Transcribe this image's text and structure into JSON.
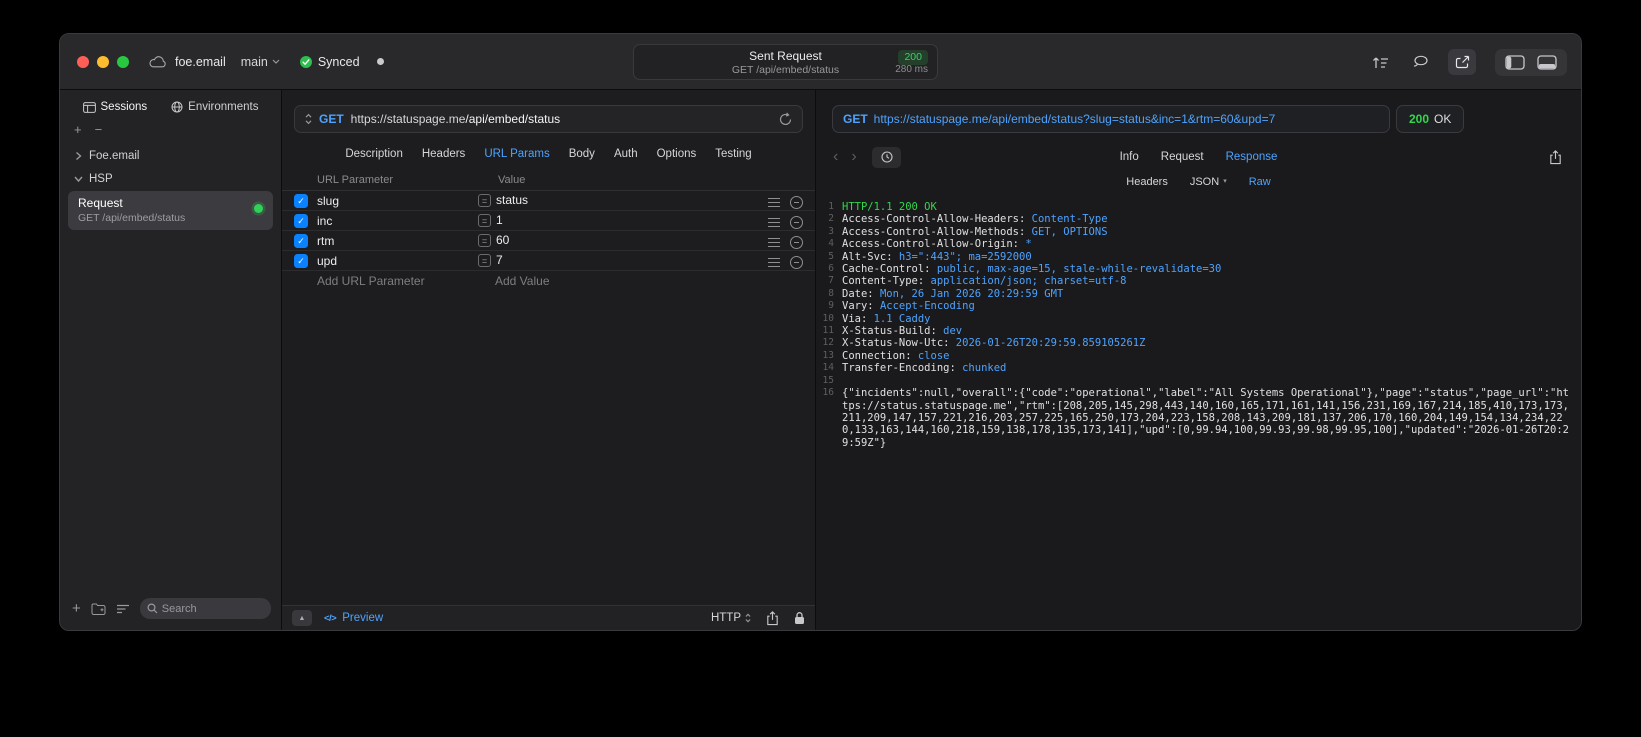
{
  "colors": {
    "accent_blue": "#4da3ff",
    "status_green": "#32d74b",
    "checkbox_blue": "#0a82ff"
  },
  "icons": {
    "check": "✓",
    "equals": "=",
    "plus": "+",
    "minus": "−",
    "triangle_up": "▲",
    "code_glyph": "</>",
    "back": "‹",
    "forward": "›",
    "dropdown_small": "▾"
  },
  "titlebar": {
    "project": "foe.email",
    "branch": "main",
    "sync_status": "Synced",
    "center": {
      "title": "Sent Request",
      "status_code": "200",
      "subtitle": "GET /api/embed/status",
      "duration": "280 ms"
    }
  },
  "sidebar": {
    "tabs": [
      {
        "label": "Sessions",
        "active": true
      },
      {
        "label": "Environments",
        "active": false
      }
    ],
    "tree": [
      {
        "label": "Foe.email",
        "expanded": false
      },
      {
        "label": "HSP",
        "expanded": true
      }
    ],
    "request_item": {
      "title": "Request",
      "subtitle": "GET /api/embed/status"
    },
    "search_placeholder": "Search"
  },
  "request_pane": {
    "method": "GET",
    "url_host": "https://statuspage.me",
    "url_path": "/api/embed/status",
    "tabs": [
      {
        "label": "Description"
      },
      {
        "label": "Headers"
      },
      {
        "label": "URL Params",
        "active": true
      },
      {
        "label": "Body"
      },
      {
        "label": "Auth"
      },
      {
        "label": "Options"
      },
      {
        "label": "Testing"
      }
    ],
    "params": {
      "columns": [
        "URL Parameter",
        "Value"
      ],
      "rows": [
        {
          "checked": true,
          "name": "slug",
          "value": "status"
        },
        {
          "checked": true,
          "name": "inc",
          "value": "1"
        },
        {
          "checked": true,
          "name": "rtm",
          "value": "60"
        },
        {
          "checked": true,
          "name": "upd",
          "value": "7"
        }
      ],
      "add_row": {
        "name": "Add URL Parameter",
        "value": "Add Value"
      }
    },
    "footer": {
      "preview_label": "Preview",
      "protocol": "HTTP"
    }
  },
  "response_pane": {
    "request_line": {
      "method": "GET",
      "url": "https://statuspage.me/api/embed/status?slug=status&inc=1&rtm=60&upd=7",
      "status_code": "200",
      "status_text": "OK"
    },
    "tabs": [
      {
        "label": "Info"
      },
      {
        "label": "Request"
      },
      {
        "label": "Response",
        "active": true
      }
    ],
    "subtabs": [
      {
        "label": "Headers"
      },
      {
        "label": "JSON",
        "dropdown": true
      },
      {
        "label": "Raw",
        "active": true
      }
    ],
    "lines": [
      {
        "n": "1",
        "parts": [
          {
            "t": "HTTP/1.1 200 OK",
            "c": "green"
          }
        ]
      },
      {
        "n": "2",
        "parts": [
          {
            "t": "Access-Control-Allow-Headers: ",
            "c": "plain"
          },
          {
            "t": "Content-Type",
            "c": "blue"
          }
        ]
      },
      {
        "n": "3",
        "parts": [
          {
            "t": "Access-Control-Allow-Methods: ",
            "c": "plain"
          },
          {
            "t": "GET, OPTIONS",
            "c": "blue"
          }
        ]
      },
      {
        "n": "4",
        "parts": [
          {
            "t": "Access-Control-Allow-Origin: ",
            "c": "plain"
          },
          {
            "t": "*",
            "c": "blue"
          }
        ]
      },
      {
        "n": "5",
        "parts": [
          {
            "t": "Alt-Svc: ",
            "c": "plain"
          },
          {
            "t": "h3=\":443\"; ma=2592000",
            "c": "blue"
          }
        ]
      },
      {
        "n": "6",
        "parts": [
          {
            "t": "Cache-Control: ",
            "c": "plain"
          },
          {
            "t": "public, max-age=15, stale-while-revalidate=30",
            "c": "blue"
          }
        ]
      },
      {
        "n": "7",
        "parts": [
          {
            "t": "Content-Type: ",
            "c": "plain"
          },
          {
            "t": "application/json; charset=utf-8",
            "c": "blue"
          }
        ]
      },
      {
        "n": "8",
        "parts": [
          {
            "t": "Date: ",
            "c": "plain"
          },
          {
            "t": "Mon, 26 Jan 2026 20:29:59 GMT",
            "c": "blue"
          }
        ]
      },
      {
        "n": "9",
        "parts": [
          {
            "t": "Vary: ",
            "c": "plain"
          },
          {
            "t": "Accept-Encoding",
            "c": "blue"
          }
        ]
      },
      {
        "n": "10",
        "parts": [
          {
            "t": "Via: ",
            "c": "plain"
          },
          {
            "t": "1.1 Caddy",
            "c": "blue"
          }
        ]
      },
      {
        "n": "11",
        "parts": [
          {
            "t": "X-Status-Build: ",
            "c": "plain"
          },
          {
            "t": "dev",
            "c": "blue"
          }
        ]
      },
      {
        "n": "12",
        "parts": [
          {
            "t": "X-Status-Now-Utc: ",
            "c": "plain"
          },
          {
            "t": "2026-01-26T20:29:59.859105261Z",
            "c": "blue"
          }
        ]
      },
      {
        "n": "13",
        "parts": [
          {
            "t": "Connection: ",
            "c": "plain"
          },
          {
            "t": "close",
            "c": "blue"
          }
        ]
      },
      {
        "n": "14",
        "parts": [
          {
            "t": "Transfer-Encoding: ",
            "c": "plain"
          },
          {
            "t": "chunked",
            "c": "blue"
          }
        ]
      },
      {
        "n": "15",
        "parts": []
      },
      {
        "n": "16",
        "wrap": true,
        "parts": [
          {
            "t": "{\"incidents\":null,\"overall\":{\"code\":\"operational\",\"label\":\"All Systems Operational\"},\"page\":\"status\",\"page_url\":\"https://status.statuspage.me\",\"rtm\":[208,205,145,298,443,140,160,165,171,161,141,156,231,169,167,214,185,410,173,173,211,209,147,157,221,216,203,257,225,165,250,173,204,223,158,208,143,209,181,137,206,170,160,204,149,154,134,234,220,133,163,144,160,218,159,138,178,135,173,141],\"upd\":[0,99.94,100,99.93,99.98,99.95,100],\"updated\":\"2026-01-26T20:29:59Z\"}",
            "c": "plain"
          }
        ]
      }
    ]
  }
}
